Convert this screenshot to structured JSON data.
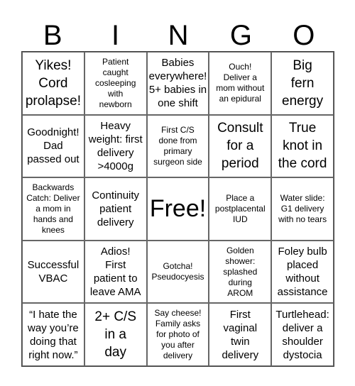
{
  "header": [
    "B",
    "I",
    "N",
    "G",
    "O"
  ],
  "cells": [
    {
      "text": "Yikes!\nCord\nprolapse!",
      "size": "l"
    },
    {
      "text": "Patient\ncaught\ncosleeping\nwith\nnewborn",
      "size": "s"
    },
    {
      "text": "Babies\neverywhere!\n5+ babies in\none shift",
      "size": "m"
    },
    {
      "text": "Ouch!\nDeliver a\nmom without\nan epidural",
      "size": "s"
    },
    {
      "text": "Big\nfern\nenergy",
      "size": "l"
    },
    {
      "text": "Goodnight!\nDad\npassed out",
      "size": "m"
    },
    {
      "text": "Heavy\nweight: first\ndelivery\n>4000g",
      "size": "m"
    },
    {
      "text": "First C/S\ndone from\nprimary\nsurgeon side",
      "size": "s"
    },
    {
      "text": "Consult\nfor a\nperiod",
      "size": "l"
    },
    {
      "text": "True\nknot in\nthe cord",
      "size": "l"
    },
    {
      "text": "Backwards\nCatch: Deliver\na mom in\nhands and\nknees",
      "size": "s"
    },
    {
      "text": "Continuity\npatient\ndelivery",
      "size": "m"
    },
    {
      "text": "Free!",
      "size": "f"
    },
    {
      "text": "Place a\npostplacental\nIUD",
      "size": "s"
    },
    {
      "text": "Water slide:\nG1 delivery\nwith no tears",
      "size": "s"
    },
    {
      "text": "Successful\nVBAC",
      "size": "m"
    },
    {
      "text": "Adios!\nFirst\npatient to\nleave AMA",
      "size": "m"
    },
    {
      "text": "Gotcha!\nPseudocyesis",
      "size": "s"
    },
    {
      "text": "Golden\nshower:\nsplashed\nduring\nAROM",
      "size": "s"
    },
    {
      "text": "Foley bulb\nplaced\nwithout\nassistance",
      "size": "m"
    },
    {
      "text": "“I hate the\nway you’re\ndoing that\nright now.”",
      "size": "m"
    },
    {
      "text": "2+ C/S\nin a\nday",
      "size": "l"
    },
    {
      "text": "Say cheese!\nFamily asks\nfor photo of\nyou after\ndelivery",
      "size": "s"
    },
    {
      "text": "First\nvaginal\ntwin\ndelivery",
      "size": "m"
    },
    {
      "text": "Turtlehead:\ndeliver a\nshoulder\ndystocia",
      "size": "m"
    }
  ]
}
